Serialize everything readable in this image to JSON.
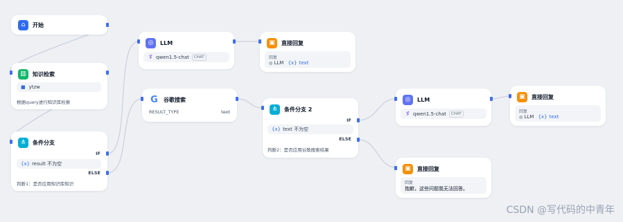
{
  "colors": {
    "accent": "#2e6bf0",
    "edge": "#c9cfdb",
    "canvas_bg": "#eef0f4"
  },
  "nodes": {
    "start": {
      "title": "开始",
      "icon": "home-icon"
    },
    "knowledge": {
      "title": "知识检索",
      "icon": "book-icon",
      "dataset": "ytzw",
      "desc": "根据query进行知识库检索"
    },
    "cond1": {
      "title": "条件分支",
      "icon": "branch-icon",
      "if_label": "IF",
      "condition_var": "{x}",
      "condition": "result 不为空",
      "else_label": "ELSE",
      "desc": "判断1：是否应用知识库知识"
    },
    "llm1": {
      "title": "LLM",
      "icon": "brain-icon",
      "model": "qwen1.5-chat",
      "mode": "CHAT"
    },
    "reply1": {
      "title": "直接回复",
      "icon": "reply-icon",
      "answer_label": "回复",
      "var_icon": "{x}",
      "source": "LLM",
      "var": "text"
    },
    "google": {
      "title": "谷歌搜索",
      "icon": "google-icon",
      "output_name": "RESULT_TYPE",
      "output_type": "text"
    },
    "cond2": {
      "title": "条件分支 2",
      "icon": "branch-icon",
      "if_label": "IF",
      "condition_var": "{x}",
      "condition": "text 不为空",
      "else_label": "ELSE",
      "desc": "判断2：是否应用谷歌搜索结果"
    },
    "llm2": {
      "title": "LLM",
      "icon": "brain-icon",
      "model": "qwen1.5-chat",
      "mode": "CHAT"
    },
    "reply2": {
      "title": "直接回复",
      "icon": "reply-icon",
      "answer_label": "回复",
      "var_icon": "{x}",
      "source": "LLM",
      "var": "text"
    },
    "reply3": {
      "title": "直接回复",
      "icon": "reply-icon",
      "answer_label": "回复",
      "text": "抱歉，这些问题我无法回答。"
    }
  },
  "watermark": "CSDN @写代码的中青年"
}
